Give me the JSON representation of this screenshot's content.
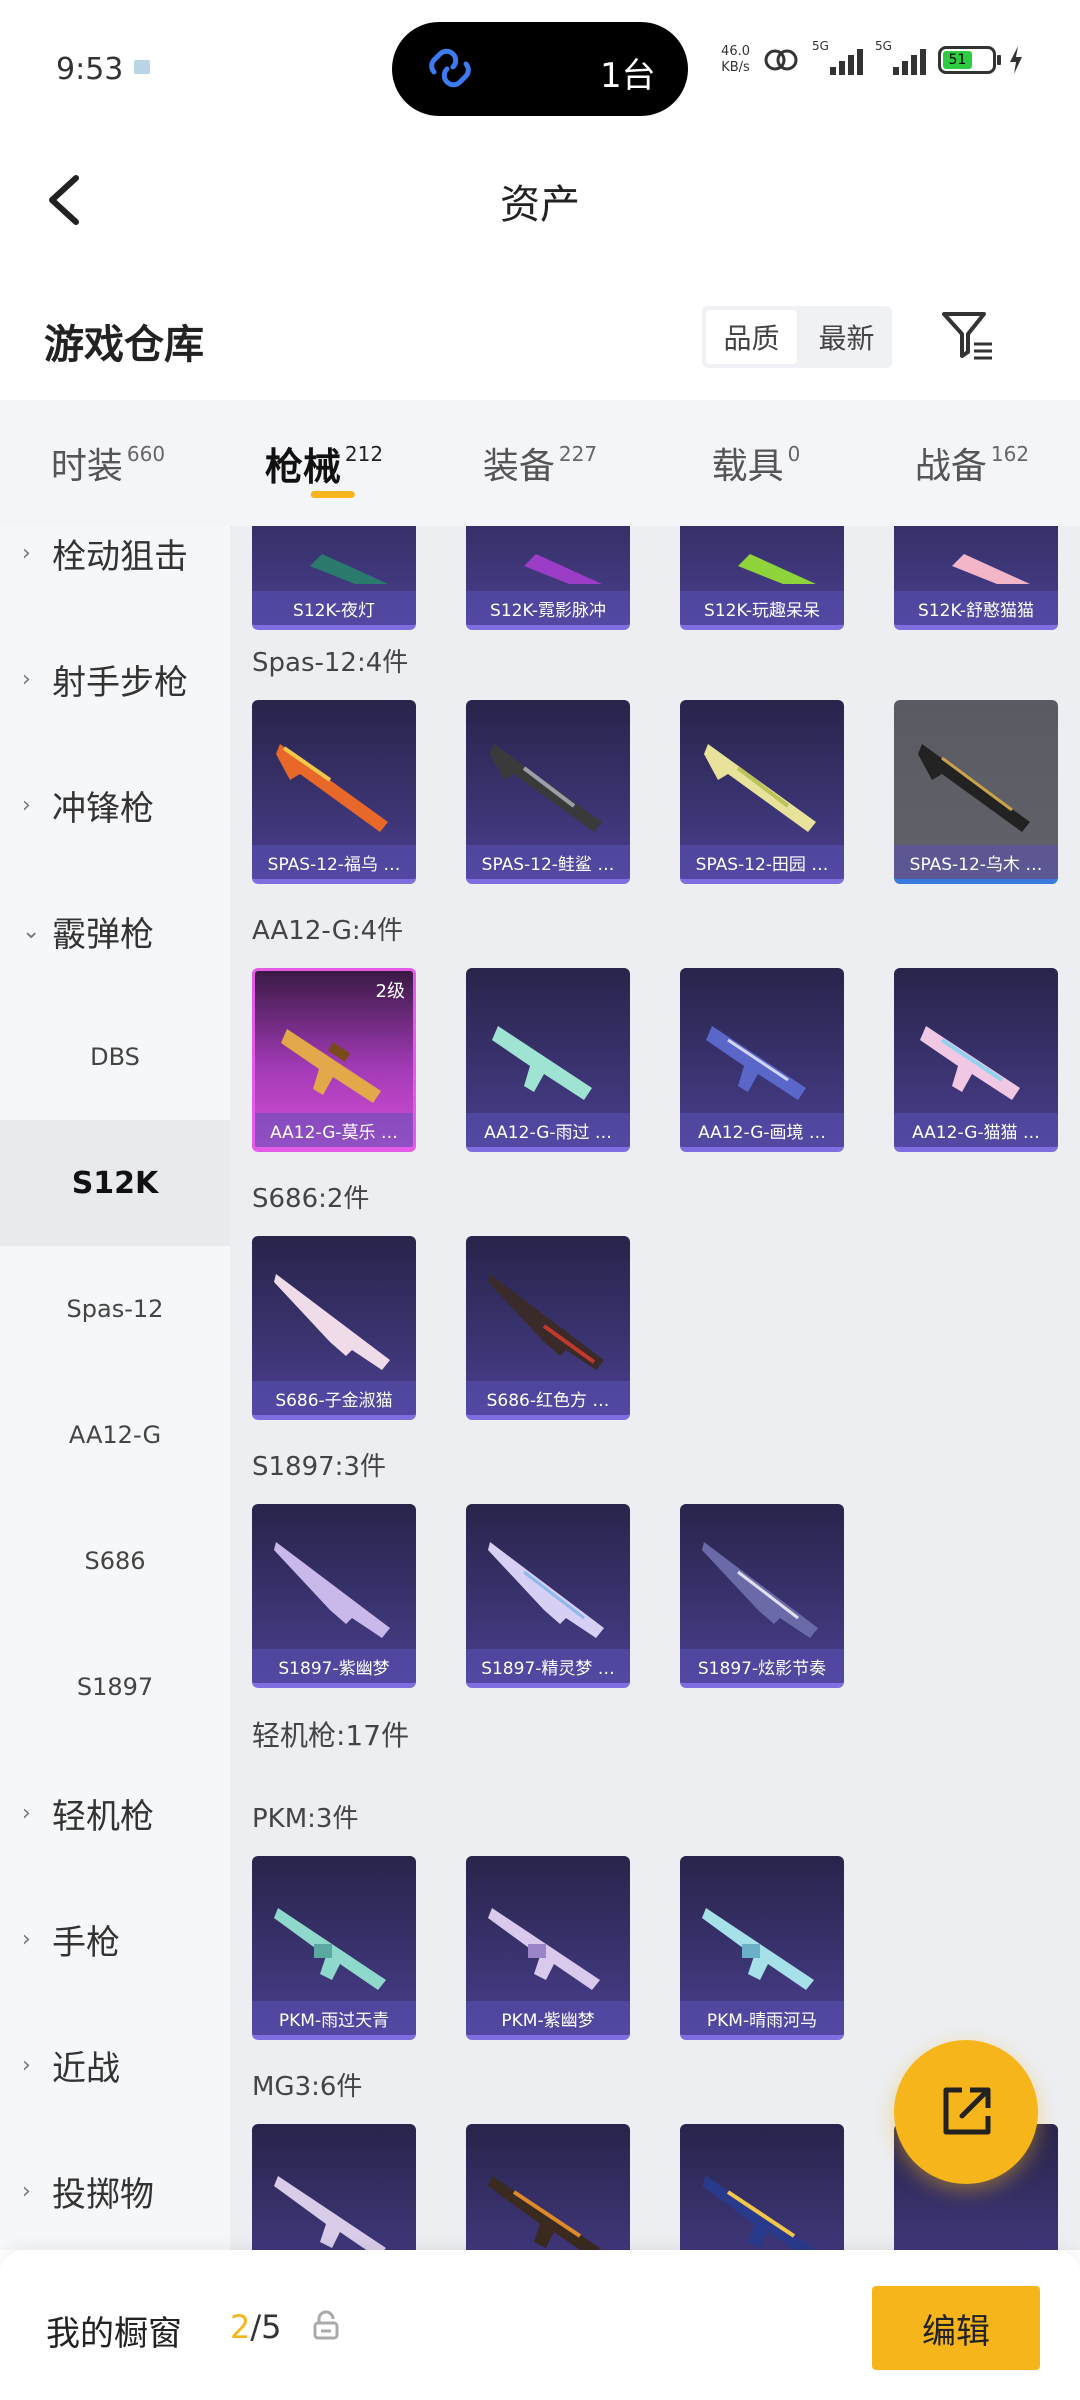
{
  "status": {
    "time": "9:53",
    "island_text": "1台",
    "net_speed_value": "46.0",
    "net_speed_unit": "KB/s",
    "sim1": "5G",
    "sim2": "5G",
    "battery": "51"
  },
  "header": {
    "title": "资产"
  },
  "warehouse": {
    "title": "游戏仓库",
    "sort_quality": "品质",
    "sort_newest": "最新"
  },
  "tabs": [
    {
      "label": "时装",
      "count": "660"
    },
    {
      "label": "枪械",
      "count": "212"
    },
    {
      "label": "装备",
      "count": "227"
    },
    {
      "label": "载具",
      "count": "0"
    },
    {
      "label": "战备",
      "count": "162"
    }
  ],
  "sidebar": [
    {
      "label": "栓动狙击",
      "type": "group"
    },
    {
      "label": "射手步枪",
      "type": "group"
    },
    {
      "label": "冲锋枪",
      "type": "group"
    },
    {
      "label": "霰弹枪",
      "type": "group-open"
    },
    {
      "label": "DBS",
      "type": "sub"
    },
    {
      "label": "S12K",
      "type": "sub-selected"
    },
    {
      "label": "Spas-12",
      "type": "sub"
    },
    {
      "label": "AA12-G",
      "type": "sub"
    },
    {
      "label": "S686",
      "type": "sub"
    },
    {
      "label": "S1897",
      "type": "sub"
    },
    {
      "label": "轻机枪",
      "type": "group"
    },
    {
      "label": "手枪",
      "type": "group"
    },
    {
      "label": "近战",
      "type": "group"
    },
    {
      "label": "投掷物",
      "type": "group"
    }
  ],
  "sections": {
    "s12k": {
      "items": [
        "S12K-夜灯",
        "S12K-霓影脉冲",
        "S12K-玩趣呆呆",
        "S12K-舒憨猫猫"
      ]
    },
    "spas": {
      "label": "Spas-12:4件",
      "items": [
        "SPAS-12-福乌 …",
        "SPAS-12-鲑鲨 …",
        "SPAS-12-田园 …",
        "SPAS-12-乌木 …"
      ]
    },
    "aa12": {
      "label": "AA12-G:4件",
      "level_badge": "2级",
      "items": [
        "AA12-G-莫乐 …",
        "AA12-G-雨过 …",
        "AA12-G-画境 …",
        "AA12-G-猫猫 …"
      ]
    },
    "s686": {
      "label": "S686:2件",
      "items": [
        "S686-子金淑猫",
        "S686-红色方 …"
      ]
    },
    "s1897": {
      "label": "S1897:3件",
      "items": [
        "S1897-紫幽梦",
        "S1897-精灵梦 …",
        "S1897-炫影节奏"
      ]
    },
    "lmg": {
      "label": "轻机枪:17件"
    },
    "pkm": {
      "label": "PKM:3件",
      "items": [
        "PKM-雨过天青",
        "PKM-紫幽梦",
        "PKM-晴雨河马"
      ]
    },
    "mg3": {
      "label": "MG3:6件"
    }
  },
  "bottom": {
    "label": "我的橱窗",
    "current": "2",
    "total": "/5",
    "edit": "编辑"
  },
  "colors": {
    "accent": "#f6b51a",
    "card_purple": "#3b3472",
    "legendary_pink": "#d54fd6"
  }
}
